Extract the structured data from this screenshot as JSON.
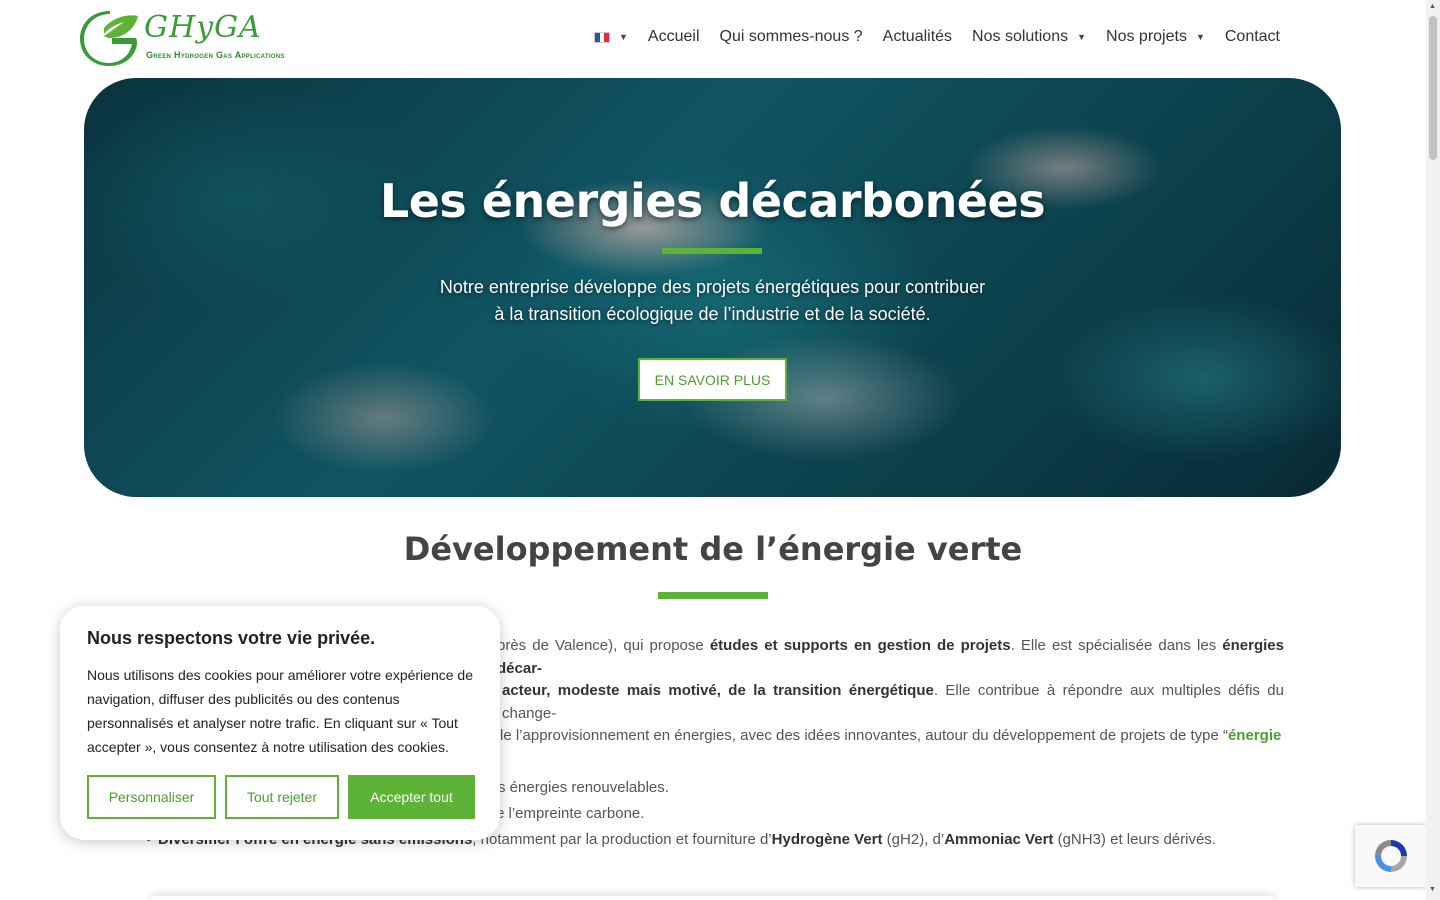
{
  "brand": {
    "logo_text": "GHyGA",
    "tagline": "Green Hydrogen Gas Applications",
    "green": "#5cb335"
  },
  "nav": {
    "language_icon": "france-flag-icon",
    "items": [
      {
        "label": "Accueil",
        "dropdown": false
      },
      {
        "label": "Qui sommes-nous ?",
        "dropdown": false
      },
      {
        "label": "Actualités",
        "dropdown": false
      },
      {
        "label": "Nos solutions",
        "dropdown": true
      },
      {
        "label": "Nos projets",
        "dropdown": true
      },
      {
        "label": "Contact",
        "dropdown": false
      }
    ]
  },
  "hero": {
    "title": "Les énergies décarbonées",
    "text_line1": "Notre entreprise développe des projets énergétiques pour contribuer",
    "text_line2": "à la transition écologique de l’industrie et de la société.",
    "button": "EN SAVOIR PLUS"
  },
  "section": {
    "title": "Développement de l’énergie verte",
    "para": {
      "p1": "près de Valence), qui propose ",
      "b1": "études et supports en gestion de projets",
      "p2": ". Elle est spécialisée dans les ",
      "b2": "énergies décar-",
      "b3": "acteur, modeste mais motivé, de la transition énergétique",
      "p3": ". Elle contribue à répondre aux multiples défis du change-",
      "p4": "le l’approvisionnement en énergies, avec des idées innovantes, autour du développement de projets de type “",
      "link": "énergie"
    },
    "bullets": {
      "b1": "s énergies renouvelables.",
      "b2": "e l’empreinte carbone.",
      "b3_bold": "Diversifier l’offre en énergie sans émissions",
      "b3_text1": ", notamment par la production et fourniture d’",
      "b3_bold2": "Hydrogène Vert",
      "b3_text2": " (gH2), d’",
      "b3_bold3": "Ammoniac Vert",
      "b3_text3": " (gNH3) et leurs dérivés."
    }
  },
  "cookie": {
    "title": "Nous respectons votre vie privée.",
    "text": "Nous utilisons des cookies pour améliorer votre expérience de navigation, diffuser des publicités ou des contenus personnalisés et analyser notre trafic. En cliquant sur « Tout accepter », vous consentez à notre utilisation des cookies.",
    "customize": "Personnaliser",
    "reject": "Tout rejeter",
    "accept": "Accepter tout"
  }
}
